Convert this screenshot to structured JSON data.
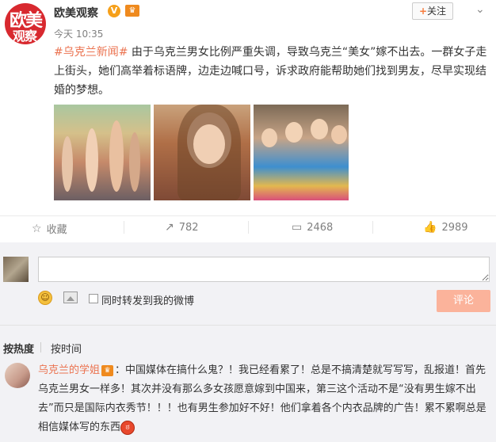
{
  "post": {
    "avatar_text_line1": "欧美",
    "avatar_text_line2": "观察",
    "author": "欧美观察",
    "verified_icon": "v-verified-icon",
    "level_icon": "vip-level-icon",
    "follow_label": "关注",
    "time": "今天 10:35",
    "hashtag": "#乌克兰新闻#",
    "body": " 由于乌克兰男女比例严重失调，导致乌克兰“美女”嫁不出去。一群女子走上街头，她们高举着标语牌，边走边喊口号，诉求政府能帮助她们找到男友，尽早实现结婚的梦想。",
    "images": [
      "image-1",
      "image-2",
      "image-3"
    ]
  },
  "actions": {
    "favorite_label": "收藏",
    "repost_count": "782",
    "comment_count": "2468",
    "like_count": "2989"
  },
  "composer": {
    "input_value": "",
    "repost_checkbox_label": "同时转发到我的微博",
    "submit_label": "评论"
  },
  "sort": {
    "by_hot": "按热度",
    "by_time": "按时间"
  },
  "comments": [
    {
      "user": "乌克兰的学姐",
      "body_part1": "：中国媒体在搞什么鬼？！我已经看累了！总是不搞清楚就写写写，乱报道！首先乌克兰男女一样多！其次并没有那么多女孩愿意嫁到中国来，第三这个活动不是“没有男生嫁不出去”而只是国际内衣秀节！！！也有男生参加好不好！他们拿着各个内衣品牌的广告！累不累啊总是相信媒体写的东西"
    }
  ],
  "colors": {
    "accent": "#eb7350",
    "submit_disabled": "#fbb39b",
    "panel_bg": "#f2f2f5"
  }
}
